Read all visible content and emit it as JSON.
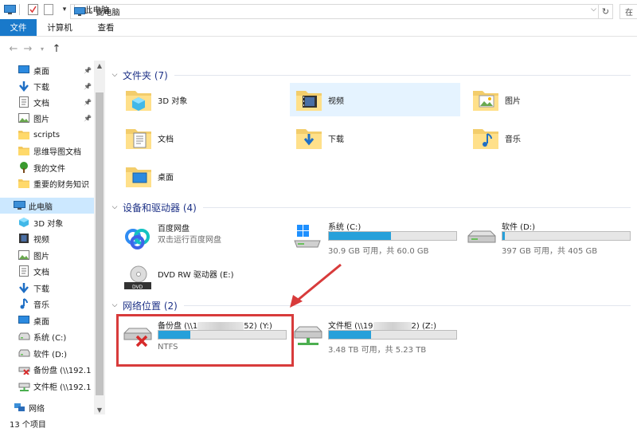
{
  "window": {
    "title": "此电脑"
  },
  "ribbon": {
    "tabs": [
      "文件",
      "计算机",
      "查看"
    ]
  },
  "address": {
    "path": "此电脑",
    "search_placeholder": "在"
  },
  "nav": {
    "items": [
      {
        "label": "桌面",
        "icon": "desktop-icon",
        "pinned": true
      },
      {
        "label": "下载",
        "icon": "download-icon",
        "pinned": true
      },
      {
        "label": "文档",
        "icon": "document-icon",
        "pinned": true
      },
      {
        "label": "图片",
        "icon": "picture-icon",
        "pinned": true
      },
      {
        "label": "scripts",
        "icon": "folder-icon",
        "pinned": false
      },
      {
        "label": "思维导图文档",
        "icon": "folder-icon",
        "pinned": false
      },
      {
        "label": "我的文件",
        "icon": "tree-icon",
        "pinned": false
      },
      {
        "label": "重要的财务知识",
        "icon": "folder-icon",
        "pinned": false
      },
      {
        "label": "此电脑",
        "icon": "computer-icon",
        "pinned": false,
        "selected": true
      },
      {
        "label": "3D 对象",
        "icon": "cube-icon",
        "pinned": false
      },
      {
        "label": "视频",
        "icon": "video-icon",
        "pinned": false
      },
      {
        "label": "图片",
        "icon": "picture-icon",
        "pinned": false
      },
      {
        "label": "文档",
        "icon": "document-icon",
        "pinned": false
      },
      {
        "label": "下载",
        "icon": "download-icon",
        "pinned": false
      },
      {
        "label": "音乐",
        "icon": "music-icon",
        "pinned": false
      },
      {
        "label": "桌面",
        "icon": "desktop-icon",
        "pinned": false
      },
      {
        "label": "系统 (C:)",
        "icon": "drive-icon",
        "pinned": false
      },
      {
        "label": "软件 (D:)",
        "icon": "drive-icon",
        "pinned": false
      },
      {
        "label": "备份盘 (\\\\192.1",
        "icon": "network-drive-error-icon",
        "pinned": false
      },
      {
        "label": "文件柜 (\\\\192.1",
        "icon": "network-drive-icon",
        "pinned": false
      },
      {
        "label": "网络",
        "icon": "network-icon",
        "pinned": false
      }
    ]
  },
  "status": {
    "count": "13 个项目"
  },
  "groups": {
    "folders": {
      "title": "文件夹 (7)",
      "items": [
        "3D 对象",
        "视频",
        "图片",
        "文档",
        "下载",
        "音乐",
        "桌面"
      ]
    },
    "devices": {
      "title": "设备和驱动器 (4)",
      "items": [
        {
          "name": "百度网盘",
          "info": "双击运行百度网盘"
        },
        {
          "name": "系统 (C:)",
          "info": "30.9 GB 可用，共 60.0 GB",
          "used_fraction": 0.485
        },
        {
          "name": "软件 (D:)",
          "info": "397 GB 可用，共 405 GB",
          "used_fraction": 0.02
        },
        {
          "name": "DVD RW 驱动器 (E:)",
          "info": ""
        }
      ]
    },
    "network": {
      "title": "网络位置 (2)",
      "items": [
        {
          "name_prefix": "备份盘 (\\\\1",
          "name_suffix": "52) (Y:)",
          "info": "NTFS",
          "used_fraction": 0.25
        },
        {
          "name_prefix": "文件柜 (\\\\19",
          "name_suffix": "2) (Z:)",
          "info": "3.48 TB 可用，共 5.23 TB",
          "used_fraction": 0.33
        }
      ]
    }
  },
  "colors": {
    "accent": "#1979ca",
    "drive_fill": "#26a0da",
    "group_title": "#1e3287",
    "selection": "#cce8ff",
    "annotation_red": "#d83b3b"
  }
}
